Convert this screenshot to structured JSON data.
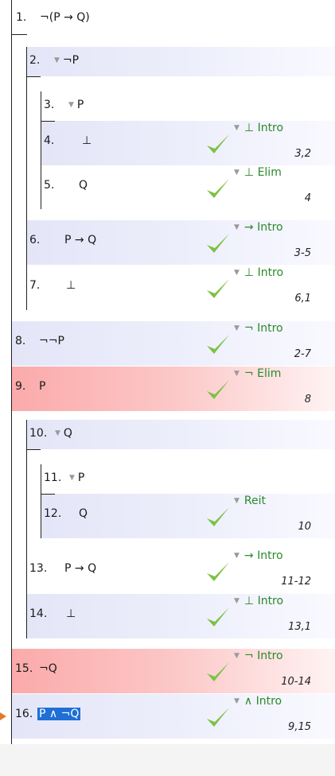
{
  "proof": {
    "lines": [
      {
        "num": "1.",
        "formula": "¬(P → Q)"
      },
      {
        "num": "2.",
        "formula": "¬P"
      },
      {
        "num": "3.",
        "formula": "P"
      },
      {
        "num": "4.",
        "formula": "⊥",
        "rule": "⊥ Intro",
        "refs": "3,2"
      },
      {
        "num": "5.",
        "formula": "Q",
        "rule": "⊥ Elim",
        "refs": "4"
      },
      {
        "num": "6.",
        "formula": "P → Q",
        "rule": "→ Intro",
        "refs": "3-5"
      },
      {
        "num": "7.",
        "formula": "⊥",
        "rule": "⊥ Intro",
        "refs": "6,1"
      },
      {
        "num": "8.",
        "formula": "¬¬P",
        "rule": "¬ Intro",
        "refs": "2-7"
      },
      {
        "num": "9.",
        "formula": "P",
        "rule": "¬ Elim",
        "refs": "8"
      },
      {
        "num": "10.",
        "formula": "Q"
      },
      {
        "num": "11.",
        "formula": "P"
      },
      {
        "num": "12.",
        "formula": "Q",
        "rule": "Reit",
        "refs": "10"
      },
      {
        "num": "13.",
        "formula": "P → Q",
        "rule": "→ Intro",
        "refs": "11-12"
      },
      {
        "num": "14.",
        "formula": "⊥",
        "rule": "⊥ Intro",
        "refs": "13,1"
      },
      {
        "num": "15.",
        "formula": "¬Q",
        "rule": "¬ Intro",
        "refs": "10-14"
      },
      {
        "num": "16.",
        "formula": "P ∧ ¬Q",
        "rule": "∧ Intro",
        "refs": "9,15"
      }
    ]
  },
  "colors": {
    "error_row": "#fbaaaa",
    "subproof_row": "#e4e6f8",
    "rule_text": "#2a8a2a",
    "check_mark": "#7cc243",
    "selection": "#1f6fd6",
    "focus_arrow": "#e07a2e"
  }
}
